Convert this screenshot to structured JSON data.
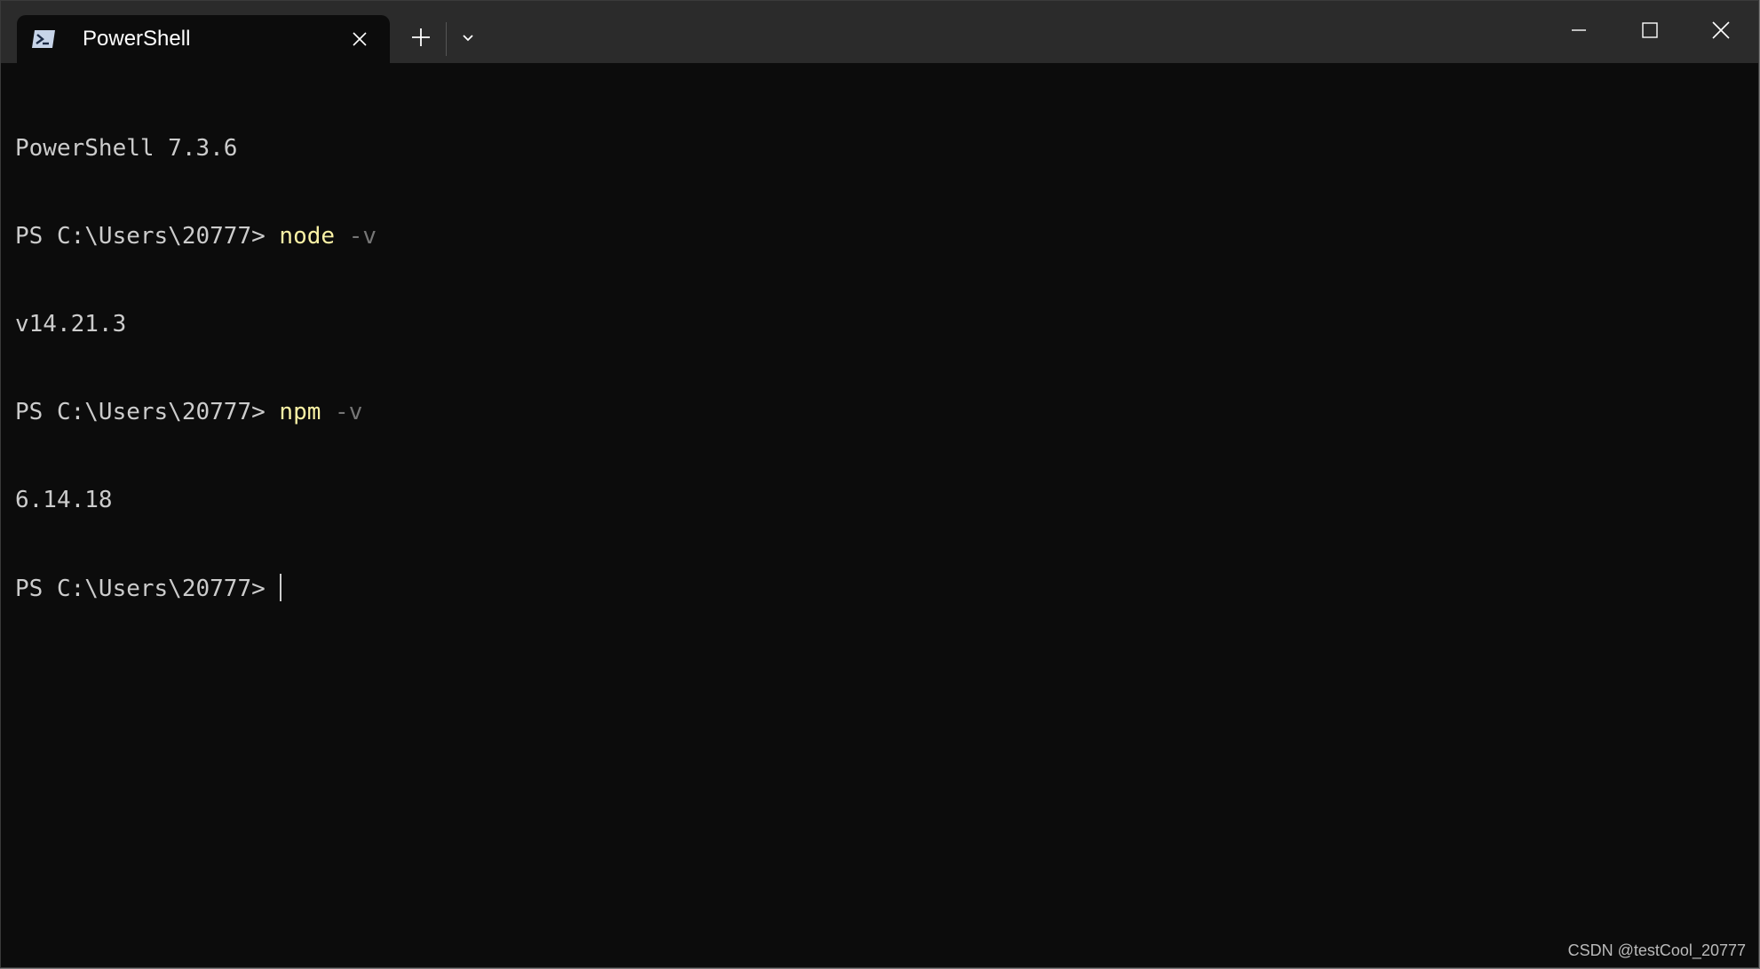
{
  "tab": {
    "title": "PowerShell",
    "icon": "powershell-icon"
  },
  "titlebar": {
    "new_tab_icon": "plus-icon",
    "dropdown_icon": "chevron-down-icon",
    "minimize_icon": "minimize-icon",
    "maximize_icon": "maximize-icon",
    "close_icon": "close-icon"
  },
  "terminal": {
    "lines": [
      {
        "text": "PowerShell 7.3.6"
      },
      {
        "prompt": "PS C:\\Users\\20777> ",
        "command": "node",
        "arg": " -v"
      },
      {
        "text": "v14.21.3"
      },
      {
        "prompt": "PS C:\\Users\\20777> ",
        "command": "npm",
        "arg": " -v"
      },
      {
        "text": "6.14.18"
      },
      {
        "prompt": "PS C:\\Users\\20777> "
      }
    ]
  },
  "colors": {
    "background": "#0c0c0c",
    "titlebar": "#2b2b2b",
    "text": "#cccccc",
    "command": "#f9f1a5",
    "argument": "#767676"
  },
  "watermark": "CSDN @testCool_20777"
}
